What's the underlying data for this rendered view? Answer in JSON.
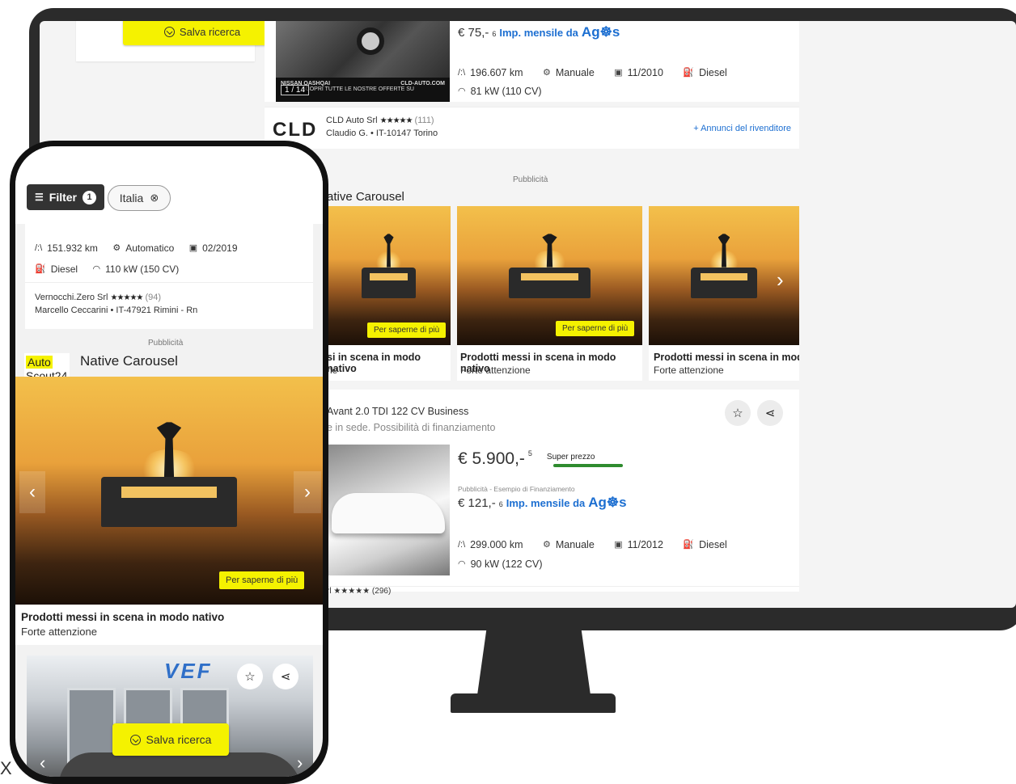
{
  "desktop": {
    "sidebar": {
      "save_search_label": "Salva ricerca"
    },
    "listing1": {
      "photo_model": "NISSAN QASHQAI",
      "photo_brand": "CLD-AUTO.COM",
      "photo_caption": "SCOPRI TUTTE LE NOSTRE OFFERTE SU",
      "photo_counter": "1 / 14",
      "monthly_price": "€ 75,-",
      "monthly_sup": "6",
      "agos_text": "Imp. mensile da",
      "agos_logo": "Ag☸s",
      "mileage": "196.607 km",
      "gearbox": "Manuale",
      "registration": "11/2010",
      "fuel": "Diesel",
      "power": "81 kW (110 CV)"
    },
    "dealer1": {
      "logo": "CLD",
      "name": "CLD Auto Srl",
      "stars": "★★★★★",
      "reviews": "(111)",
      "contact": "Claudio G. • IT-10147 Torino",
      "more_link": "+ Annunci del rivenditore"
    },
    "ad": {
      "pub_label": "Pubblicità",
      "carousel_title": "ative Carousel",
      "learn_more": "Per saperne di più",
      "cards": [
        {
          "title": "si in scena in modo nativo",
          "subtitle": "ne"
        },
        {
          "title": "Prodotti messi in scena in modo nativo",
          "subtitle": "Forte attenzione"
        },
        {
          "title": "Prodotti messi in scena in modo",
          "subtitle": "Forte attenzione"
        }
      ]
    },
    "listing2": {
      "title": "Avant 2.0 TDI 122 CV Business",
      "subtitle": "e in sede. Possibilità di finanziamento",
      "price": "€ 5.900,-",
      "price_sup": "5",
      "badge": "Super prezzo",
      "finance_note": "Pubblicità - Esempio di Finanziamento",
      "monthly_price": "€ 121,-",
      "monthly_sup": "6",
      "agos_text": "Imp. mensile da",
      "agos_logo": "Ag☸s",
      "mileage": "299.000 km",
      "gearbox": "Manuale",
      "registration": "11/2012",
      "fuel": "Diesel",
      "power": "90 kW (122 CV)",
      "dealer_peek": "rl ★★★★★ (296)"
    }
  },
  "mobile": {
    "filter_label": "Filter",
    "filter_count": "1",
    "chip_label": "Italia",
    "listing": {
      "mileage": "151.932 km",
      "gearbox": "Automatico",
      "registration": "02/2019",
      "fuel": "Diesel",
      "power": "110 kW (150 CV)",
      "dealer_name": "Vernocchi.Zero Srl",
      "stars": "★★★★★",
      "reviews": "(94)",
      "dealer_contact": "Marcello Ceccarini • IT-47921 Rimini - Rn"
    },
    "ad": {
      "pub_label": "Pubblicità",
      "logo_top": "Auto",
      "logo_bottom": "Scout24",
      "carousel_title": "Native Carousel",
      "learn_more": "Per saperne di più",
      "card_title": "Prodotti messi in scena in modo nativo",
      "card_subtitle": "Forte attenzione"
    },
    "dealer_sign": "VEF",
    "save_search_label": "Salva ricerca"
  },
  "stray_text": "X"
}
